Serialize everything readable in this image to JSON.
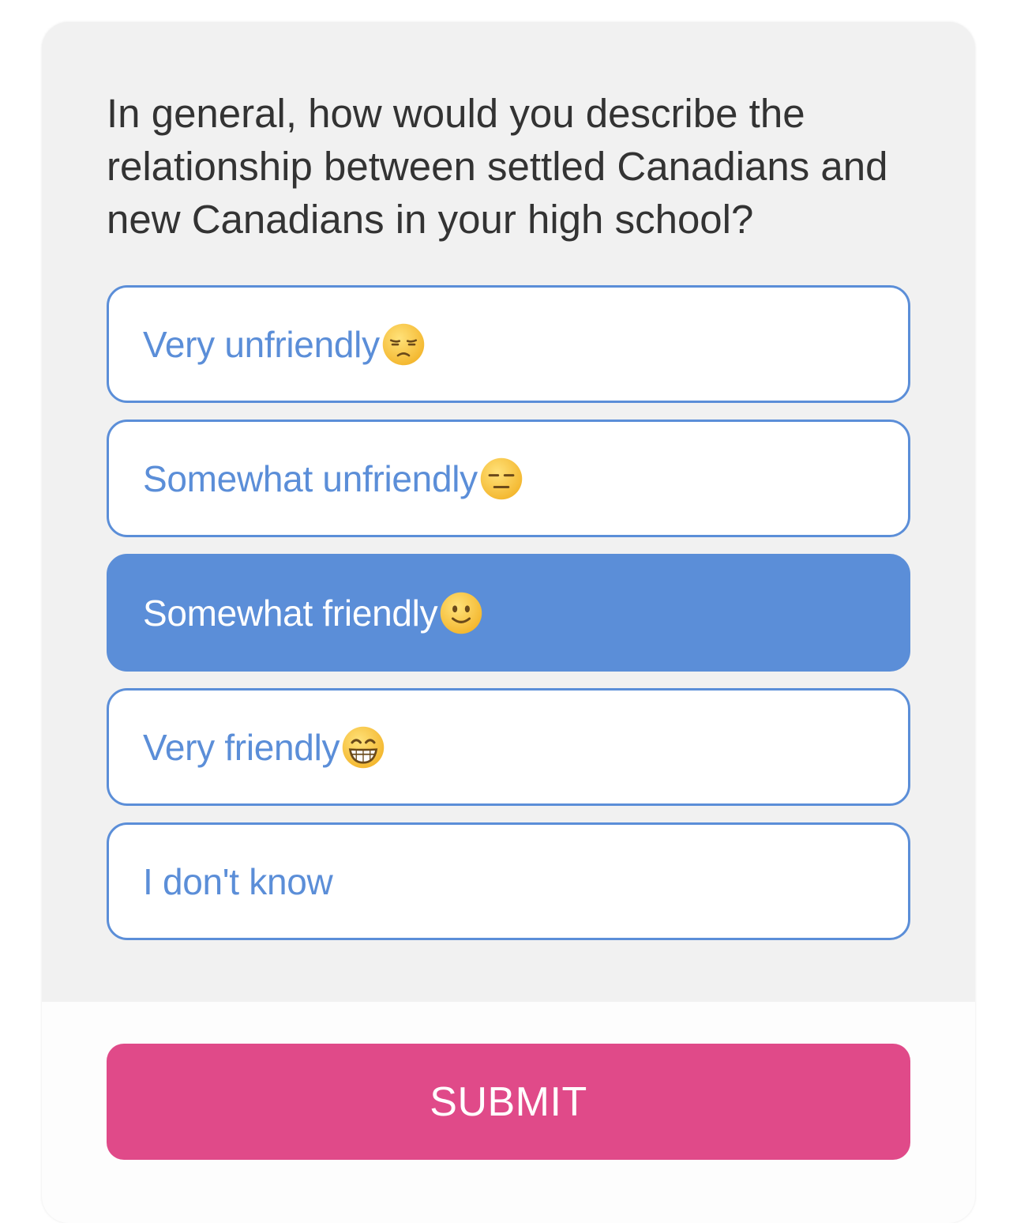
{
  "question": {
    "text": "In general, how would you describe the relationship between settled Canadians and new Canadians in your high school?"
  },
  "options": [
    {
      "label": "Very unfriendly",
      "icon": "unamused-face-icon",
      "selected": false
    },
    {
      "label": "Somewhat unfriendly",
      "icon": "expressionless-face-icon",
      "selected": false
    },
    {
      "label": "Somewhat friendly",
      "icon": "slightly-smiling-face-icon",
      "selected": true
    },
    {
      "label": "Very friendly",
      "icon": "grinning-face-icon",
      "selected": false
    },
    {
      "label": "I don't know",
      "icon": null,
      "selected": false
    }
  ],
  "submit": {
    "label": "SUBMIT"
  },
  "colors": {
    "accent_blue": "#5b8ed8",
    "submit_pink": "#e04a89",
    "card_background": "#f1f1f1",
    "question_text": "#333333"
  }
}
